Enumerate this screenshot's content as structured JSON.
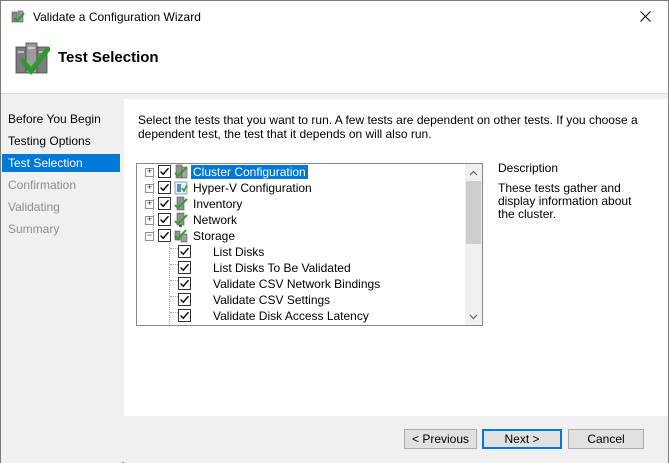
{
  "window": {
    "title": "Validate a Configuration Wizard",
    "header_title": "Test Selection"
  },
  "sidebar": {
    "items": [
      {
        "label": "Before You Begin",
        "state": "enabled"
      },
      {
        "label": "Testing Options",
        "state": "enabled"
      },
      {
        "label": "Test Selection",
        "state": "selected"
      },
      {
        "label": "Confirmation",
        "state": "disabled"
      },
      {
        "label": "Validating",
        "state": "disabled"
      },
      {
        "label": "Summary",
        "state": "disabled"
      }
    ]
  },
  "main": {
    "instructions": "Select the tests that you want to run.  A few tests are dependent on other tests.  If you choose a dependent test, the test that it depends on will also run.",
    "tree": {
      "nodes": [
        {
          "label": "Cluster Configuration",
          "checked": true,
          "expandable": true,
          "expanded": false,
          "selected": true,
          "level": 0,
          "icon": "cluster-config-icon"
        },
        {
          "label": "Hyper-V Configuration",
          "checked": true,
          "expandable": true,
          "expanded": false,
          "selected": false,
          "level": 0,
          "icon": "hyperv-config-icon"
        },
        {
          "label": "Inventory",
          "checked": true,
          "expandable": true,
          "expanded": false,
          "selected": false,
          "level": 0,
          "icon": "inventory-icon"
        },
        {
          "label": "Network",
          "checked": true,
          "expandable": true,
          "expanded": false,
          "selected": false,
          "level": 0,
          "icon": "network-icon"
        },
        {
          "label": "Storage",
          "checked": true,
          "expandable": true,
          "expanded": true,
          "selected": false,
          "level": 0,
          "icon": "storage-icon"
        },
        {
          "label": "List Disks",
          "checked": true,
          "expandable": false,
          "selected": false,
          "level": 1
        },
        {
          "label": "List Disks To Be Validated",
          "checked": true,
          "expandable": false,
          "selected": false,
          "level": 1
        },
        {
          "label": "Validate CSV Network Bindings",
          "checked": true,
          "expandable": false,
          "selected": false,
          "level": 1
        },
        {
          "label": "Validate CSV Settings",
          "checked": true,
          "expandable": false,
          "selected": false,
          "level": 1
        },
        {
          "label": "Validate Disk Access Latency",
          "checked": true,
          "expandable": false,
          "selected": false,
          "level": 1
        }
      ]
    },
    "description": {
      "title": "Description",
      "text": "These tests gather and display information about the cluster."
    }
  },
  "footer": {
    "previous_label": "< Previous",
    "next_label": "Next >",
    "cancel_label": "Cancel"
  },
  "colors": {
    "selection": "#0078d7",
    "check_green": "#3a9a2a"
  }
}
